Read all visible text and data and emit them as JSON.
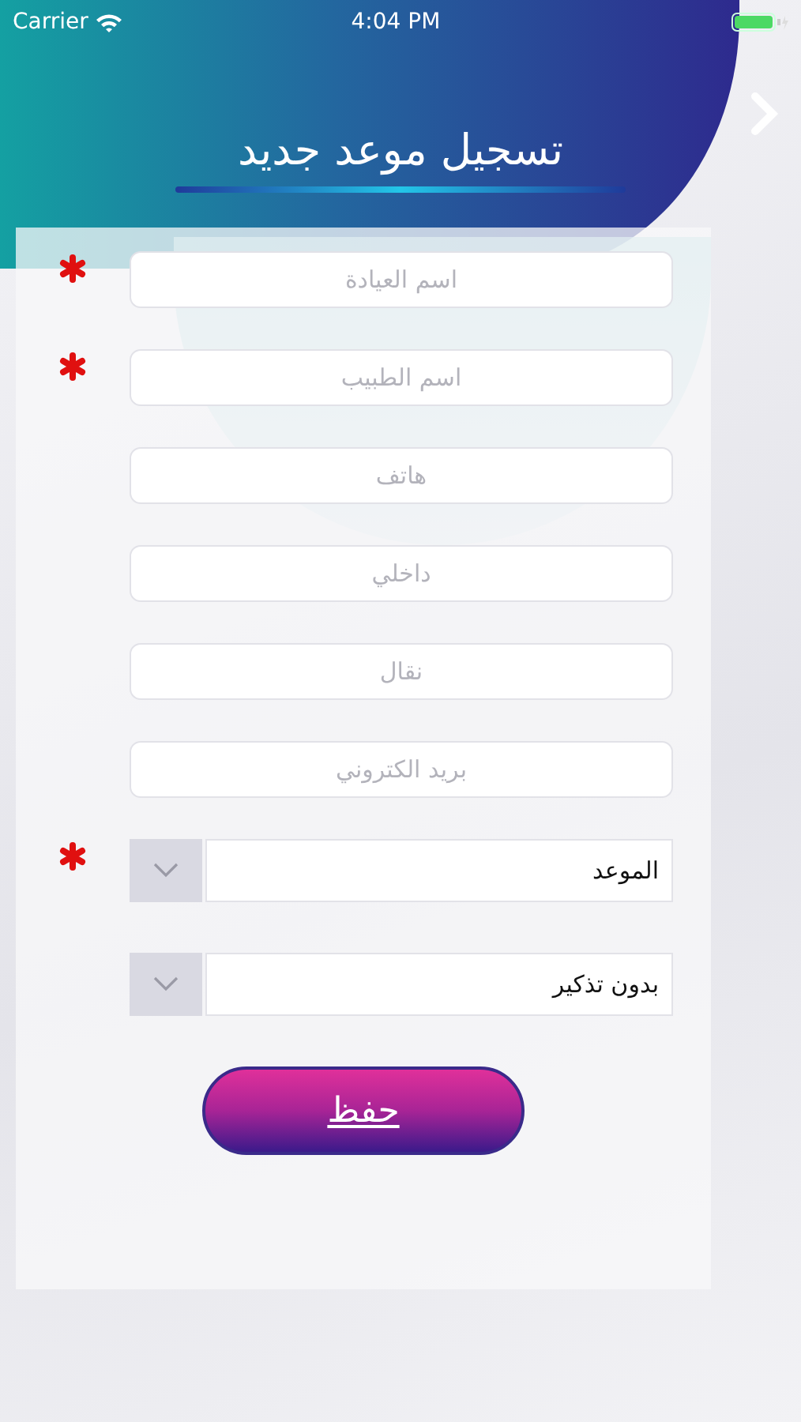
{
  "status_bar": {
    "carrier": "Carrier",
    "time": "4:04 PM"
  },
  "header": {
    "title": "تسجيل موعد جديد"
  },
  "fields": [
    {
      "kind": "text",
      "placeholder": "اسم العيادة",
      "required": true
    },
    {
      "kind": "text",
      "placeholder": "اسم الطبيب",
      "required": true
    },
    {
      "kind": "text",
      "placeholder": "هاتف",
      "required": false
    },
    {
      "kind": "text",
      "placeholder": "داخلي",
      "required": false
    },
    {
      "kind": "text",
      "placeholder": "نقال",
      "required": false
    },
    {
      "kind": "text",
      "placeholder": "بريد الكتروني",
      "required": false
    },
    {
      "kind": "select",
      "value": "الموعد",
      "required": true
    },
    {
      "kind": "select",
      "value": "بدون تذكير",
      "required": false
    }
  ],
  "save_button": {
    "label": "حفظ"
  }
}
